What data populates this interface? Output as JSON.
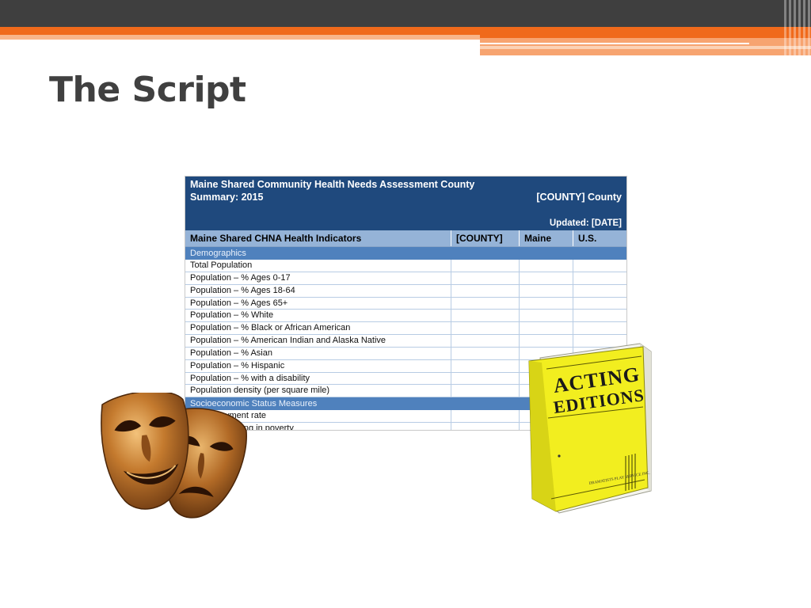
{
  "slide": {
    "title": "The Script"
  },
  "table": {
    "header_line1": "Maine Shared Community Health Needs Assessment County",
    "header_line2": "Summary: 2015",
    "county_label": "[COUNTY] County",
    "updated_label": "Updated: [DATE]",
    "columns": [
      "Maine Shared CHNA Health Indicators",
      "[COUNTY]",
      "Maine",
      "U.S."
    ],
    "section1": "Demographics",
    "rows": [
      "Total Population",
      "Population – % Ages 0-17",
      "Population – % Ages 18-64",
      "Population – % Ages 65+",
      "Population – % White",
      "Population – % Black or African American",
      "Population – % American Indian and Alaska Native",
      "Population – % Asian",
      "Population – % Hispanic",
      "Population – % with a disability",
      "Population density (per square mile)"
    ],
    "section2": "Socioeconomic Status Measures",
    "rows2": [
      "Unemployment rate",
      "Individuals living in poverty"
    ]
  },
  "book": {
    "title_line1": "ACTING",
    "title_line2": "EDITIONS",
    "publisher": "DRAMATISTS PLAY SERVICE INC."
  },
  "icons": {
    "masks": "theatre-masks-icon",
    "book": "script-book-icon"
  },
  "colors": {
    "top_bar": "#3f3f3f",
    "accent_orange": "#f06a1b",
    "table_header": "#1f497d",
    "table_colhead": "#95b3d7",
    "table_section": "#4f81bd",
    "book_yellow": "#f2ee1f",
    "mask_gold": "#b8702a"
  }
}
